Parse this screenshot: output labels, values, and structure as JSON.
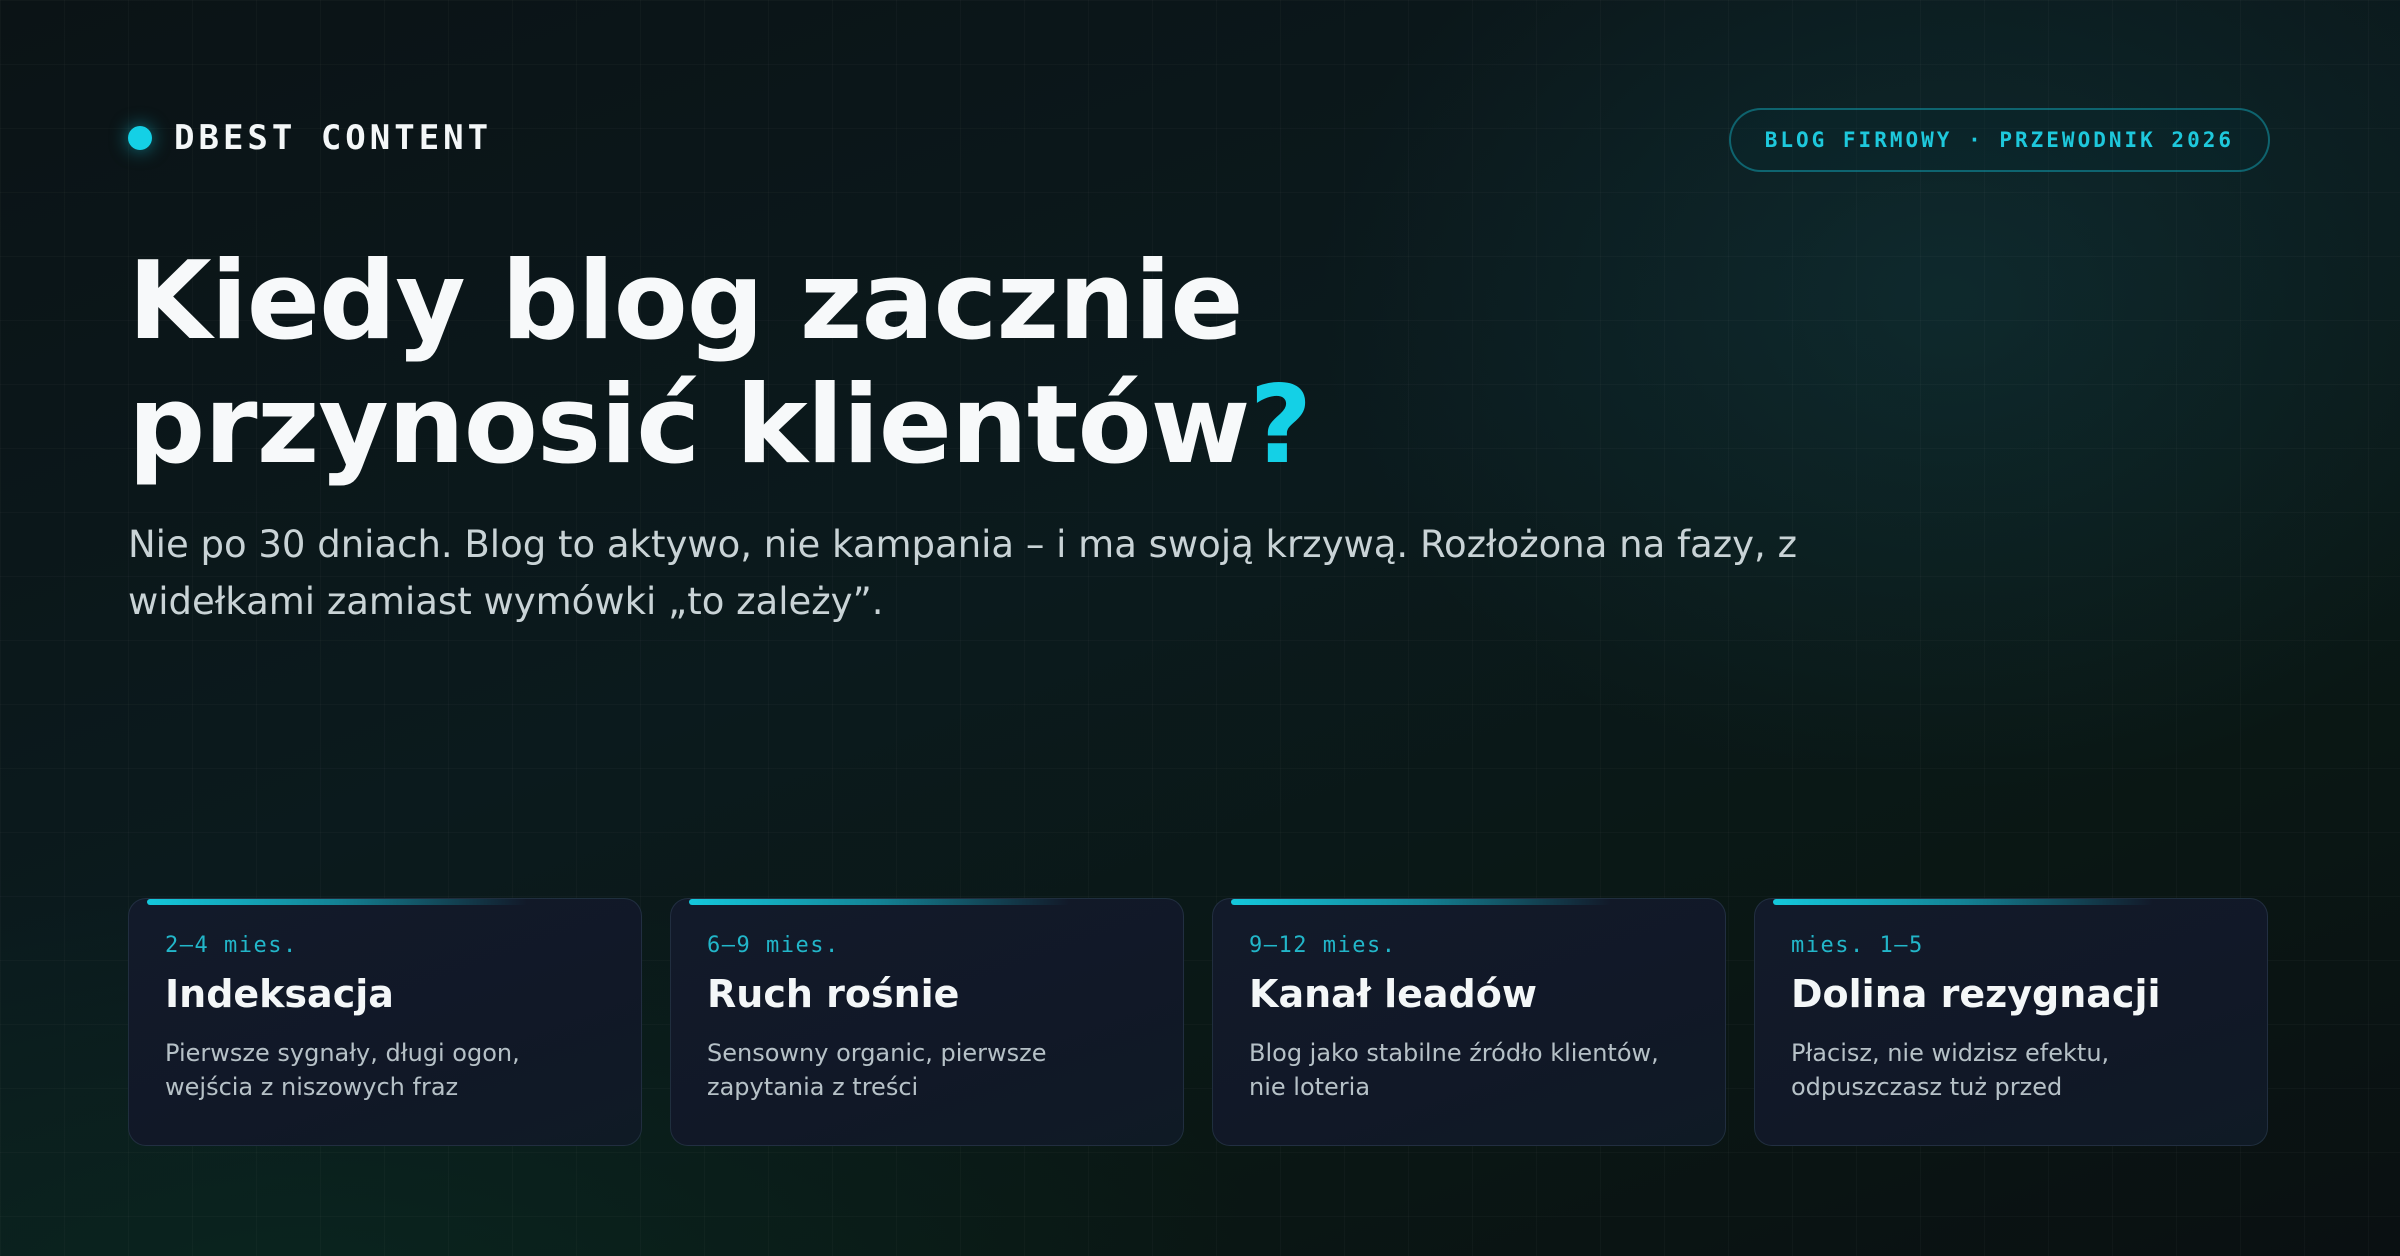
{
  "brand": {
    "name": "DBEST CONTENT",
    "dot_color": "#14d0e6"
  },
  "tag": {
    "label": "BLOG FIRMOWY · PRZEWODNIK 2026"
  },
  "hero": {
    "title_line1": "Kiedy blog zacznie",
    "title_line2": "przynosić klientów",
    "title_accent": "?",
    "subtitle": "Nie po 30 dniach. Blog to aktywo, nie kampania – i ma swoją krzywą. Rozłożona na fazy, z widełkami zamiast wymówki „to zależy”."
  },
  "phases": [
    {
      "range": "2–4 mies.",
      "title": "Indeksacja",
      "description": "Pierwsze sygnały, długi ogon, wejścia z niszowych fraz"
    },
    {
      "range": "6–9 mies.",
      "title": "Ruch rośnie",
      "description": "Sensowny organic, pierwsze zapytania z treści"
    },
    {
      "range": "9–12 mies.",
      "title": "Kanał leadów",
      "description": "Blog jako stabilne źródło klientów, nie loteria"
    },
    {
      "range": "mies. 1–5",
      "title": "Dolina rezygnacji",
      "description": "Płacisz, nie widzisz efektu, odpuszczasz tuż przed"
    }
  ],
  "colors": {
    "accent": "#14d0e6",
    "background": "#0b1518",
    "card_background": "#111827"
  }
}
